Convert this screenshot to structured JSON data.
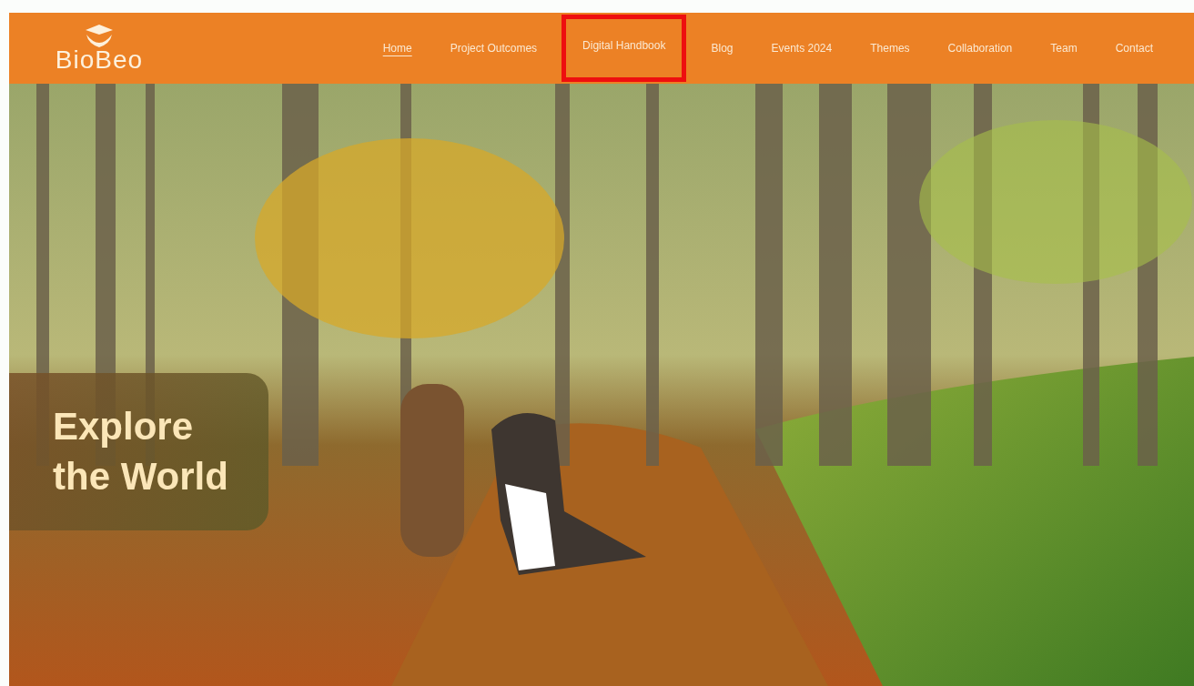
{
  "header": {
    "logo": {
      "text": "BioBeo"
    },
    "nav": [
      {
        "label": "Home",
        "selected": true,
        "highlighted": false
      },
      {
        "label": "Project Outcomes",
        "selected": false,
        "highlighted": false
      },
      {
        "label": "Digital Handbook",
        "selected": false,
        "highlighted": true
      },
      {
        "label": "Blog",
        "selected": false,
        "highlighted": false
      },
      {
        "label": "Events 2024",
        "selected": false,
        "highlighted": false
      },
      {
        "label": "Themes",
        "selected": false,
        "highlighted": false
      },
      {
        "label": "Collaboration",
        "selected": false,
        "highlighted": false
      },
      {
        "label": "Team",
        "selected": false,
        "highlighted": false
      },
      {
        "label": "Contact",
        "selected": false,
        "highlighted": false
      }
    ]
  },
  "hero": {
    "heading_lines": [
      "Explore",
      "the World"
    ]
  }
}
